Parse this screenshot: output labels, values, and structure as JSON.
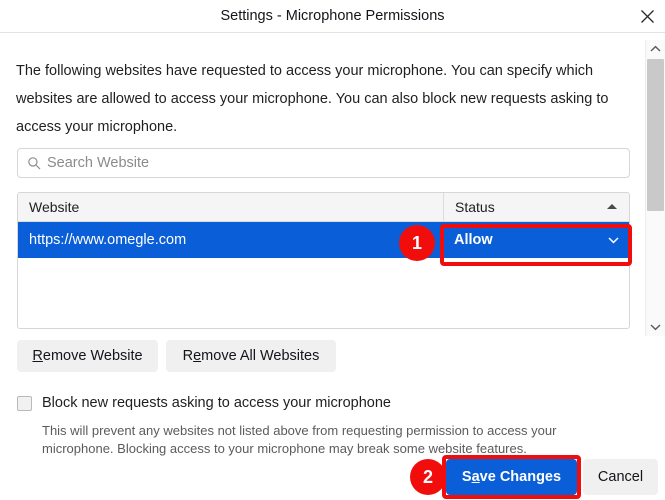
{
  "window": {
    "title": "Settings - Microphone Permissions",
    "close_icon": "close-icon"
  },
  "intro": {
    "text": "The following websites have requested to access your microphone. You can specify which websites are allowed to access your microphone. You can also block new requests asking to access your microphone."
  },
  "search": {
    "icon": "search-icon",
    "placeholder": "Search Website",
    "value": ""
  },
  "list": {
    "columns": [
      {
        "key": "website",
        "label": "Website"
      },
      {
        "key": "status",
        "label": "Status",
        "sort": "ascending",
        "sort_icon": "sort-ascending-icon"
      }
    ],
    "rows": [
      {
        "website": "https://www.omegle.com",
        "status": "Allow",
        "status_dropdown_icon": "chevron-down-icon",
        "selected": true
      }
    ]
  },
  "buttons": {
    "remove_website": {
      "prefix": "",
      "accel": "R",
      "suffix": "emove Website"
    },
    "remove_all_websites": {
      "prefix": "R",
      "accel": "e",
      "suffix": "move All Websites"
    },
    "save_changes": {
      "prefix": "S",
      "accel": "a",
      "suffix": "ve Changes"
    },
    "cancel": "Cancel"
  },
  "block_option": {
    "checked": false,
    "label": "Block new requests asking to access your microphone",
    "hint": "This will prevent any websites not listed above from requesting permission to access your microphone. Blocking access to your microphone may break some website features."
  },
  "scrollbar": {
    "up_icon": "chevron-up-icon",
    "down_icon": "chevron-down-icon"
  },
  "annotations": {
    "markers": [
      {
        "number": "1",
        "target": "status-dropdown"
      },
      {
        "number": "2",
        "target": "save-changes-button"
      }
    ],
    "highlight_color": "#f20d0d"
  },
  "colors": {
    "accent_blue": "#0a5fd8",
    "annotation_red": "#f20d0d",
    "button_gray": "#f0f0f0"
  }
}
